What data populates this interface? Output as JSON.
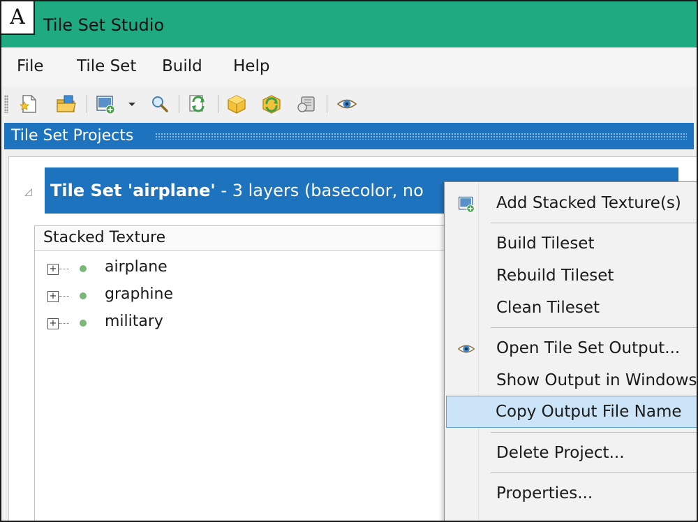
{
  "panel_label": "A",
  "app": {
    "title": "Tile Set Studio"
  },
  "menu": [
    "File",
    "Tile Set",
    "Build",
    "Help"
  ],
  "toolbar": {
    "icons": [
      "new-project-icon",
      "open-folder-icon",
      "add-texture-icon",
      "dropdown-arrow-icon",
      "search-icon",
      "refresh-icon",
      "build-box-icon",
      "rebuild-box-icon",
      "clean-icon",
      "eye-icon"
    ]
  },
  "panel": {
    "title": "Tile Set Projects"
  },
  "project": {
    "name": "Tile Set 'airplane'",
    "details": "- 3 layers (basecolor, no"
  },
  "table": {
    "header": "Stacked Texture",
    "rows": [
      "airplane",
      "graphine",
      "military"
    ]
  },
  "context_menu": {
    "items": [
      {
        "label": "Add Stacked Texture(s)",
        "icon": "add-texture-icon"
      },
      {
        "label": "Build Tileset"
      },
      {
        "label": "Rebuild Tileset"
      },
      {
        "label": "Clean Tileset"
      },
      {
        "label": "Open Tile Set Output...",
        "icon": "eye-icon"
      },
      {
        "label": "Show Output in Windows E"
      },
      {
        "label": "Copy Output File Name",
        "highlighted": true
      },
      {
        "label": "Delete Project..."
      },
      {
        "label": "Properties..."
      }
    ]
  },
  "colors": {
    "title_bar": "#1faa82",
    "panel_header": "#1e73be",
    "selection": "#1e73be",
    "menu_highlight": "#cce4f7",
    "status_dot": "#7ab87a"
  }
}
